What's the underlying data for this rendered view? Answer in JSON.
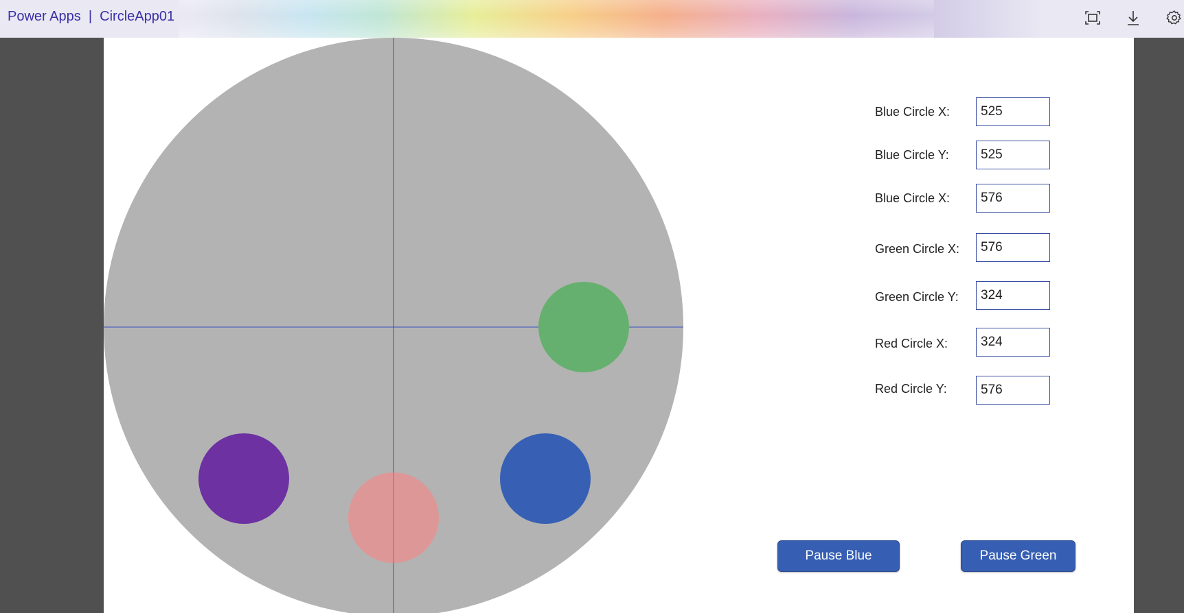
{
  "header": {
    "title": "Power Apps  |  CircleApp01",
    "icons": [
      "fullscreen-icon",
      "download-icon",
      "settings-icon"
    ]
  },
  "stage": {
    "colors": {
      "board": "#b3b3b3",
      "crosshair": "#3a4fc0",
      "green": "#66b06f",
      "purple": "#6d31a2",
      "pink": "#de9797",
      "blue": "#3760b4"
    }
  },
  "fields": [
    {
      "label": "Blue Circle X:",
      "value": "525"
    },
    {
      "label": "Blue Circle Y:",
      "value": "525"
    },
    {
      "label": "Blue Circle X:",
      "value": "576"
    },
    {
      "label": "Green Circle X:",
      "value": "576"
    },
    {
      "label": "Green Circle Y:",
      "value": "324"
    },
    {
      "label": "Red Circle X:",
      "value": "324"
    },
    {
      "label": "Red Circle Y:",
      "value": "576"
    }
  ],
  "buttons": {
    "pause_blue": "Pause Blue",
    "pause_green": "Pause Green"
  }
}
